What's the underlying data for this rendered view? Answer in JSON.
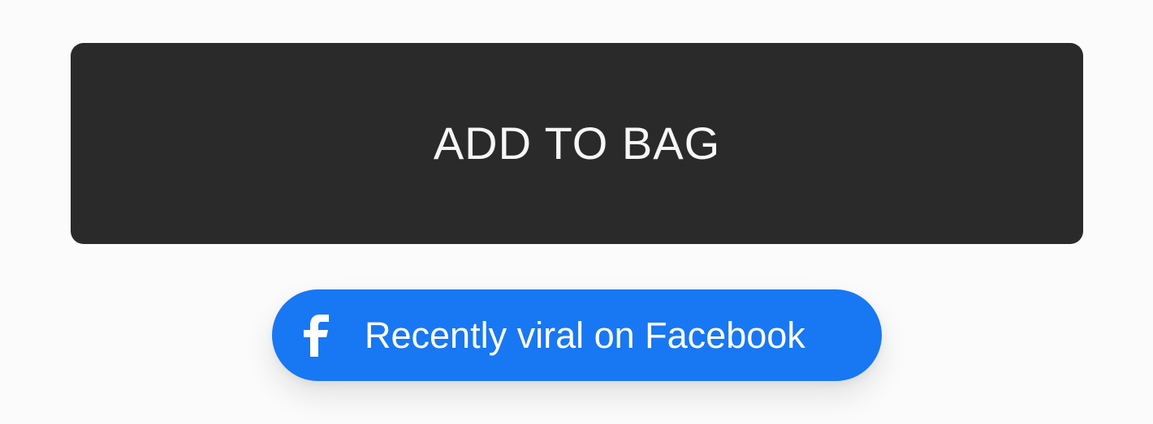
{
  "add_to_bag": {
    "label": "ADD TO BAG"
  },
  "viral_badge": {
    "icon": "facebook-icon",
    "label": "Recently viral on Facebook",
    "accent_color": "#1877f2"
  },
  "colors": {
    "background": "#fbfbfb",
    "button_dark": "#2a2a2a",
    "button_text": "#f6f6f6"
  }
}
